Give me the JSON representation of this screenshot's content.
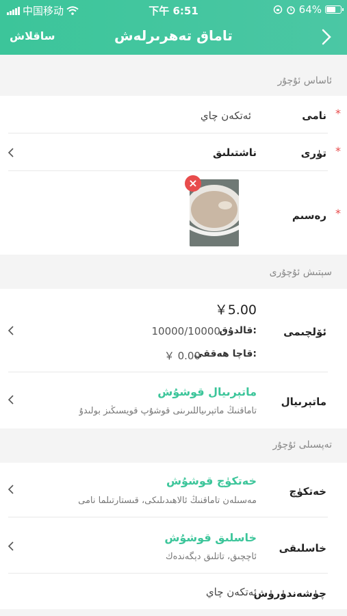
{
  "status_bar": {
    "carrier": "中国移动",
    "time": "下午 6:51",
    "battery": "64%",
    "battery_level": 0.64
  },
  "navbar": {
    "save_label": "ساقلاش",
    "title": "تاماق تەھرىرلەش"
  },
  "basic_section": {
    "title": "ئاساس ئۇچۇر",
    "name_label": "نامى",
    "name_value": "ئەتكەن چاي",
    "type_label": "تۈرى",
    "type_value": "ناشتىلىق",
    "image_label": "رەسىم"
  },
  "sale_section": {
    "title": "سېتىش ئۇچۇرى",
    "spec_label": "ئۆلچىمى",
    "price": "￥5.00",
    "stock_label": "قالدۇق:",
    "stock_value": "10000/10000",
    "box_price_label": "قاچا ھەققى:",
    "box_price_value": "￥ 0.00",
    "material_label": "ماتېرىيال",
    "material_action": "ماتېرىيال قوشۇش",
    "material_desc": "تاماقنىڭ ماتېرىياللىرىنى قوشۇپ قويسىڭىز بولىدۇ"
  },
  "detail_section": {
    "title": "تەپسىلى ئۇچۇر",
    "feature_label": "خەتكۈچ",
    "feature_action": "خەتكۈچ قوشۇش",
    "feature_desc": "مەسىلەن تاماقنىڭ ئالاھىدىلىكى، قىستارتىلما نامى",
    "taste_label": "خاسلىقى",
    "taste_action": "خاسلىق قوشۇش",
    "taste_desc": "ئاچچىق، تاتلىق دېگەندەك",
    "desc_label": "چۈشەندۈرۈش",
    "desc_value": "ئەتكەن چاي"
  },
  "icons": {
    "back": "chevron-right-icon",
    "row_arrow": "chevron-left-icon",
    "delete": "close-icon",
    "wifi": "wifi-icon",
    "alarm": "alarm-icon",
    "lock": "rotation-lock-icon"
  },
  "colors": {
    "accent": "#3cc59a",
    "required": "#e84c4c"
  }
}
